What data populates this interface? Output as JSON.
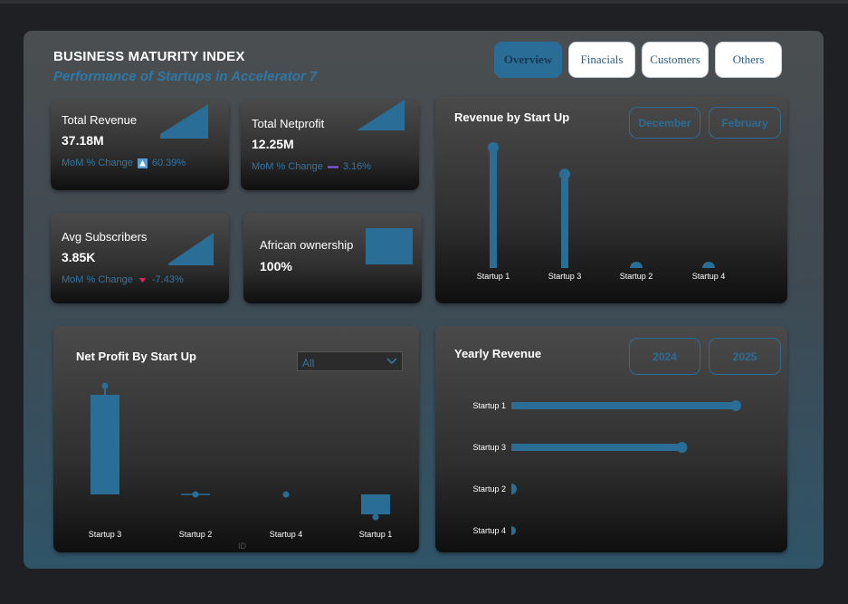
{
  "header": {
    "title": "BUSINESS MATURITY INDEX",
    "subtitle": "Performance of Startups in Accelerator 7"
  },
  "nav": {
    "overview": "Overview",
    "financials": "Finacials",
    "customers": "Customers",
    "others": "Others"
  },
  "kpis": {
    "total_revenue": {
      "label": "Total Revenue",
      "value": "37.18M",
      "change_label": "MoM % Change",
      "change_value": "60.39%",
      "trend": "up"
    },
    "total_netprofit": {
      "label": "Total Netprofit",
      "value": "12.25M",
      "change_label": "MoM % Change",
      "change_value": "3.16%",
      "trend": "flat"
    },
    "avg_subscribers": {
      "label": "Avg Subscribers",
      "value": "3.85K",
      "change_label": "MoM % Change",
      "change_value": "-7.43%",
      "trend": "down"
    },
    "african_ownership": {
      "label": "African ownership",
      "value": "100%"
    }
  },
  "revenue_by_startup": {
    "title": "Revenue by Start Up",
    "slicers": [
      "December",
      "February"
    ]
  },
  "net_profit_by_startup": {
    "title": "Net Profit By Start Up",
    "dropdown_value": "All",
    "axis_hint": "ID"
  },
  "yearly_revenue": {
    "title": "Yearly Revenue",
    "slicers": [
      "2024",
      "2025"
    ]
  },
  "colors": {
    "accent": "#2a6d96",
    "up": "#5b9bd5",
    "flat": "#8b5cf6",
    "down": "#e0245e"
  },
  "chart_data": [
    {
      "type": "bar",
      "title": "Revenue by Start Up",
      "categories": [
        "Startup 1",
        "Startup 3",
        "Startup 2",
        "Startup 4"
      ],
      "values": [
        100,
        78,
        2,
        1
      ]
    },
    {
      "type": "bar",
      "title": "Net Profit By Start Up",
      "categories": [
        "Startup 3",
        "Startup 2",
        "Startup 4",
        "Startup 1"
      ],
      "values": [
        100,
        0.5,
        0,
        -20
      ]
    },
    {
      "type": "bar",
      "title": "Yearly Revenue",
      "orientation": "horizontal",
      "categories": [
        "Startup 1",
        "Startup 3",
        "Startup 2",
        "Startup 4"
      ],
      "values": [
        100,
        76,
        1,
        0.5
      ]
    }
  ]
}
